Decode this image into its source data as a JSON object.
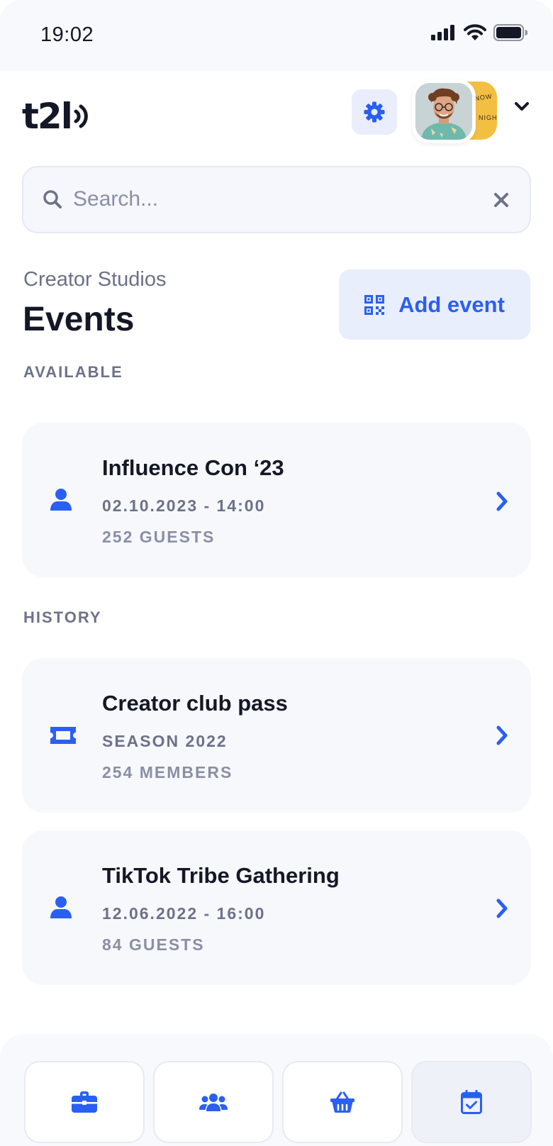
{
  "status": {
    "time": "19:02"
  },
  "header": {
    "logo_text": "t2l",
    "avatar_back_text": [
      "E NOW",
      "NIGH"
    ]
  },
  "search": {
    "placeholder": "Search...",
    "value": ""
  },
  "page": {
    "org_name": "Creator Studios",
    "title": "Events",
    "add_button_label": "Add event"
  },
  "sections": {
    "available_label": "AVAILABLE",
    "history_label": "HISTORY"
  },
  "available": [
    {
      "title": "Influence Con ‘23",
      "line1": "02.10.2023 - 14:00",
      "line2": "252 GUESTS",
      "icon": "user-icon"
    }
  ],
  "history": [
    {
      "title": "Creator club pass",
      "line1": "SEASON 2022",
      "line2": "254 MEMBERS",
      "icon": "ticket-icon"
    },
    {
      "title": "TikTok Tribe Gathering",
      "line1": "12.06.2022 - 16:00",
      "line2": "84 GUESTS",
      "icon": "user-icon"
    }
  ],
  "bottom_nav": [
    {
      "icon": "briefcase-icon",
      "active": false
    },
    {
      "icon": "users-icon",
      "active": false
    },
    {
      "icon": "basket-icon",
      "active": false
    },
    {
      "icon": "calendar-check-icon",
      "active": true
    }
  ],
  "colors": {
    "accent": "#2a5ff3",
    "text": "#141826",
    "muted": "#6d7289",
    "card_bg": "#f7f8fb",
    "accent_bg": "#e9eefc"
  }
}
